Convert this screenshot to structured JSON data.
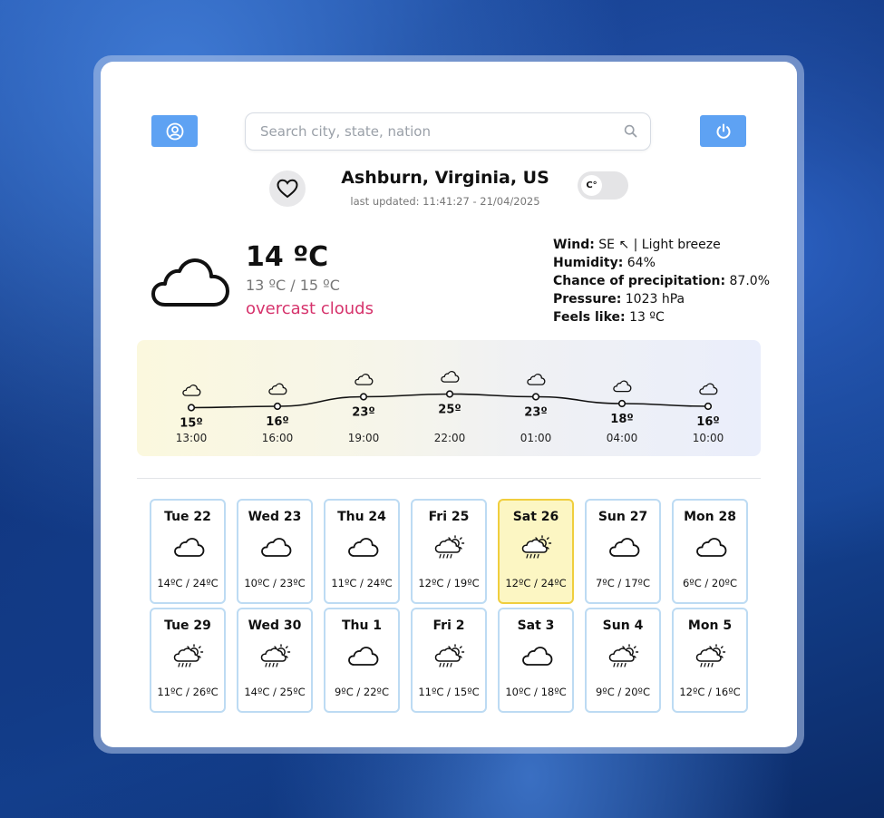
{
  "header": {
    "search_placeholder": "Search city, state, nation",
    "profile_icon": "user-circle-icon",
    "power_icon": "power-icon"
  },
  "location": {
    "city": "Ashburn, Virginia, US",
    "last_updated": "last updated: 11:41:27 - 21/04/2025",
    "unit_toggle": "C°"
  },
  "current": {
    "icon": "cloud-icon",
    "temp": "14 ºC",
    "minmax": "13 ºC / 15 ºC",
    "description": "overcast clouds",
    "details": [
      {
        "label": "Wind:",
        "value": "SE ↖ | Light breeze"
      },
      {
        "label": "Humidity:",
        "value": "64%"
      },
      {
        "label": "Chance of precipitation:",
        "value": "87.0%"
      },
      {
        "label": "Pressure:",
        "value": "1023 hPa"
      },
      {
        "label": "Feels like:",
        "value": "13 ºC"
      }
    ]
  },
  "hourly": [
    {
      "time": "13:00",
      "temp": 15,
      "label": "15º"
    },
    {
      "time": "16:00",
      "temp": 16,
      "label": "16º"
    },
    {
      "time": "19:00",
      "temp": 23,
      "label": "23º"
    },
    {
      "time": "22:00",
      "temp": 25,
      "label": "25º"
    },
    {
      "time": "01:00",
      "temp": 23,
      "label": "23º"
    },
    {
      "time": "04:00",
      "temp": 18,
      "label": "18º"
    },
    {
      "time": "10:00",
      "temp": 16,
      "label": "16º"
    }
  ],
  "daily": [
    {
      "day": "Tue 22",
      "range": "14ºC / 24ºC",
      "icon": "cloud",
      "active": false
    },
    {
      "day": "Wed 23",
      "range": "10ºC / 23ºC",
      "icon": "cloud",
      "active": false
    },
    {
      "day": "Thu 24",
      "range": "11ºC / 24ºC",
      "icon": "cloud",
      "active": false
    },
    {
      "day": "Fri 25",
      "range": "12ºC / 19ºC",
      "icon": "sun-rain",
      "active": false
    },
    {
      "day": "Sat 26",
      "range": "12ºC / 24ºC",
      "icon": "sun-rain",
      "active": true
    },
    {
      "day": "Sun 27",
      "range": "7ºC / 17ºC",
      "icon": "cloud",
      "active": false
    },
    {
      "day": "Mon 28",
      "range": "6ºC / 20ºC",
      "icon": "cloud",
      "active": false
    },
    {
      "day": "Tue 29",
      "range": "11ºC / 26ºC",
      "icon": "sun-rain",
      "active": false
    },
    {
      "day": "Wed 30",
      "range": "14ºC / 25ºC",
      "icon": "sun-rain",
      "active": false
    },
    {
      "day": "Thu 1",
      "range": "9ºC / 22ºC",
      "icon": "cloud",
      "active": false
    },
    {
      "day": "Fri 2",
      "range": "11ºC / 15ºC",
      "icon": "sun-rain",
      "active": false
    },
    {
      "day": "Sat 3",
      "range": "10ºC / 18ºC",
      "icon": "cloud",
      "active": false
    },
    {
      "day": "Sun 4",
      "range": "9ºC / 20ºC",
      "icon": "sun-rain",
      "active": false
    },
    {
      "day": "Mon 5",
      "range": "12ºC / 16ºC",
      "icon": "sun-rain",
      "active": false
    }
  ]
}
